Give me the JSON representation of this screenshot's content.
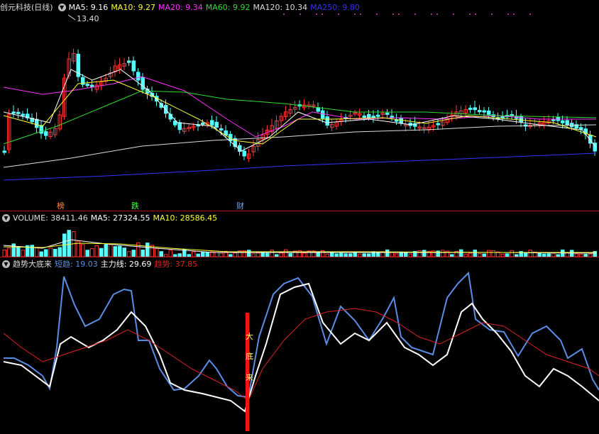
{
  "main": {
    "title": "创元科技(日线)",
    "ma": [
      {
        "label": "MA5: 9.16",
        "color": "#ffffff"
      },
      {
        "label": "MA10: 9.27",
        "color": "#ffff33"
      },
      {
        "label": "MA20: 9.34",
        "color": "#ff33ff"
      },
      {
        "label": "MA60: 9.92",
        "color": "#33dd33"
      },
      {
        "label": "MA120: 10.34",
        "color": "#dddddd"
      },
      {
        "label": "MA250: 9.80",
        "color": "#3333ff"
      }
    ],
    "high_label": "13.40",
    "events": [
      {
        "text": "榜",
        "color": "#ff8844"
      },
      {
        "text": "跌",
        "color": "#44ff44"
      },
      {
        "text": "财",
        "color": "#66aaff"
      }
    ]
  },
  "volume": {
    "title": "VOLUME: 38411.46",
    "ma5": "MA5: 27324.55",
    "ma10": "MA10: 28586.45"
  },
  "indicator": {
    "title": "趋势大底来",
    "short": "短趋: 19.03",
    "main": "主力线: 29.69",
    "trend": "趋势: 37.85",
    "signal": [
      "大",
      "底",
      "来"
    ]
  },
  "colors": {
    "up": "#ff3333",
    "down": "#55ffff",
    "short_line": "#5a8de6",
    "main_line": "#ffffff",
    "trend_line": "#dd2222",
    "signal_bar": "#ff1010"
  }
}
